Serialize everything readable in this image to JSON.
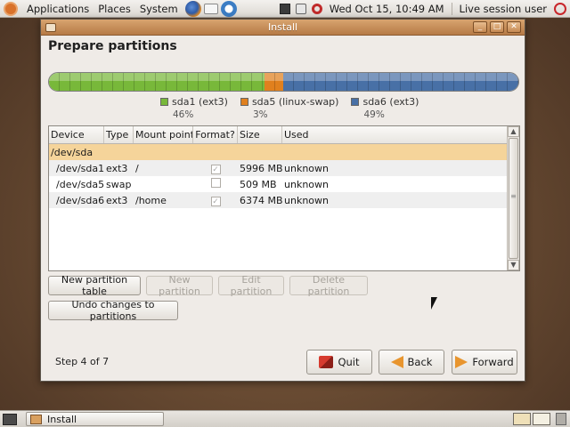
{
  "top_panel": {
    "applications": "Applications",
    "places": "Places",
    "system": "System",
    "clock": "Wed Oct 15, 10:49 AM",
    "user": "Live session user"
  },
  "window": {
    "title": "Install",
    "page_title": "Prepare partitions",
    "controls": {
      "minimize": "_",
      "maximize": "□",
      "close": "✕"
    }
  },
  "partition_bar": {
    "segments": [
      {
        "name": "sda1 (ext3)",
        "percent": "46%",
        "fraction": 0.46,
        "color": "#78b83a"
      },
      {
        "name": "sda5 (linux-swap)",
        "percent": "3%",
        "fraction": 0.04,
        "color": "#e0801e"
      },
      {
        "name": "sda6 (ext3)",
        "percent": "49%",
        "fraction": 0.5,
        "color": "#4870a6"
      }
    ]
  },
  "table": {
    "headers": {
      "device": "Device",
      "type": "Type",
      "mount": "Mount point",
      "format": "Format?",
      "size": "Size",
      "used": "Used"
    },
    "rows": [
      {
        "device": "/dev/sda",
        "type": "",
        "mount": "",
        "format": "",
        "size": "",
        "used": ""
      },
      {
        "device": "/dev/sda1",
        "type": "ext3",
        "mount": "/",
        "format": "✓",
        "size": "5996 MB",
        "used": "unknown"
      },
      {
        "device": "/dev/sda5",
        "type": "swap",
        "mount": "",
        "format": "",
        "size": "509 MB",
        "used": "unknown"
      },
      {
        "device": "/dev/sda6",
        "type": "ext3",
        "mount": "/home",
        "format": "✓",
        "size": "6374 MB",
        "used": "unknown"
      }
    ]
  },
  "buttons": {
    "new_table": "New partition table",
    "new_partition": "New partition",
    "edit_partition": "Edit partition",
    "delete_partition": "Delete partition",
    "undo": "Undo changes to partitions",
    "quit": "Quit",
    "back": "Back",
    "forward": "Forward"
  },
  "step": "Step 4 of 7",
  "taskbar": {
    "task": "Install"
  },
  "icons": {
    "menu": "ubuntu-logo-icon",
    "browser": "firefox-icon",
    "mail": "mail-icon",
    "help": "help-icon",
    "network": "network-icon",
    "volume": "volume-icon",
    "update": "update-icon",
    "power": "power-icon",
    "show_desktop": "show-desktop-icon",
    "trash": "trash-icon"
  }
}
